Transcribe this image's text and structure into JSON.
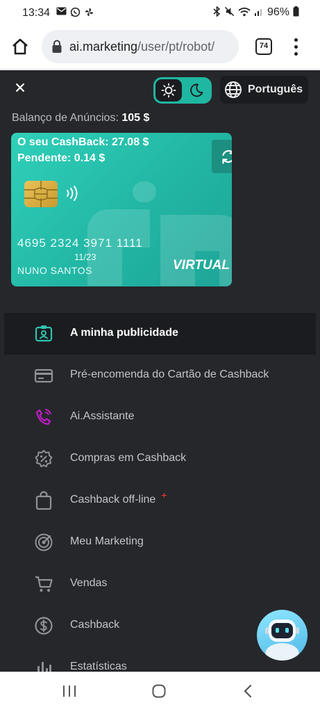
{
  "status_bar": {
    "time": "13:34",
    "left_icons": [
      "gmail-icon",
      "whatsapp-icon",
      "pinwheel-icon"
    ],
    "battery": "96%",
    "right_icons": [
      "bluetooth-icon",
      "mute-icon",
      "wifi-icon",
      "signal-icon",
      "battery-icon"
    ]
  },
  "browser": {
    "url_host": "ai.marketing",
    "url_path": "/user/pt/robot/",
    "tab_count": "74"
  },
  "header": {
    "language": "Português",
    "theme_selected": "dark"
  },
  "balance": {
    "label": "Balanço de Anúncios:",
    "value": "105 $"
  },
  "card": {
    "cashback": "O seu CashBack: 27.08 $",
    "pending": "Pendente: 0.14 $",
    "number": "4695 2324 3971 1111",
    "expiry": "11/23",
    "holder": "NUNO SANTOS",
    "type": "VIRTUAL",
    "color": "#22b6a4"
  },
  "menu": {
    "items": [
      {
        "label": "A minha publicidade",
        "icon": "id-badge-icon",
        "active": true
      },
      {
        "label": "Pré-encomenda do Cartão de Cashback",
        "icon": "credit-card-icon",
        "active": false
      },
      {
        "label": "Ai.Assistante",
        "icon": "phone-ring-icon",
        "active": false
      },
      {
        "label": "Compras em Cashback",
        "icon": "percent-badge-icon",
        "active": false
      },
      {
        "label": "Cashback off-line",
        "icon": "shopping-bag-icon",
        "active": false,
        "badge": "+"
      },
      {
        "label": "Meu Marketing",
        "icon": "target-icon",
        "active": false
      },
      {
        "label": "Vendas",
        "icon": "cart-icon",
        "active": false
      },
      {
        "label": "Cashback",
        "icon": "dollar-circle-icon",
        "active": false
      },
      {
        "label": "Estatísticas",
        "icon": "bar-chart-icon",
        "active": false
      }
    ]
  },
  "colors": {
    "accent": "#1fb7a1",
    "background": "#26272b",
    "active_row": "#1b1c20",
    "assistant_icon": "#c21bc8"
  }
}
